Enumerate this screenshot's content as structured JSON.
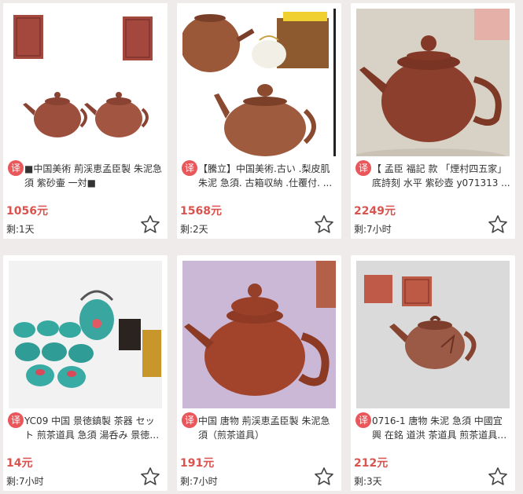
{
  "badge_text": "译",
  "items": [
    {
      "title": "■中国美術 荊渓恵孟臣製 朱泥急須 紫砂壷 一対■",
      "price": "1056元",
      "remaining": "剩:1天"
    },
    {
      "title": "【騰立】中国美術.古い .梨皮肌 朱泥 急須. 古箱収納 .仕覆付. ...",
      "price": "1568元",
      "remaining": "剩:2天"
    },
    {
      "title": "【 孟臣 福記 款 「煙村四五家」 底詩刻 水平 紫砂壺 y071313 ...",
      "price": "2249元",
      "remaining": "剩:7小时"
    },
    {
      "title": "YC09 中国 景徳鎮製 茶器 セット 煎茶道具 急須 湯呑み 景徳鎮 ...",
      "price": "14元",
      "remaining": "剩:7小时"
    },
    {
      "title": "中国 唐物 荊渓恵孟臣製 朱泥急須（煎茶道具）",
      "price": "191元",
      "remaining": "剩:7小时"
    },
    {
      "title": "0716-1 唐物 朱泥 急須 中國宜興 在銘 道洪 茶道具 煎茶道具 中...",
      "price": "212元",
      "remaining": "剩:3天"
    }
  ],
  "icons": {
    "favorite": "star-outline-icon"
  },
  "colors": {
    "badge": "#e9575b",
    "price": "#d9534f",
    "background": "#efebeb"
  }
}
